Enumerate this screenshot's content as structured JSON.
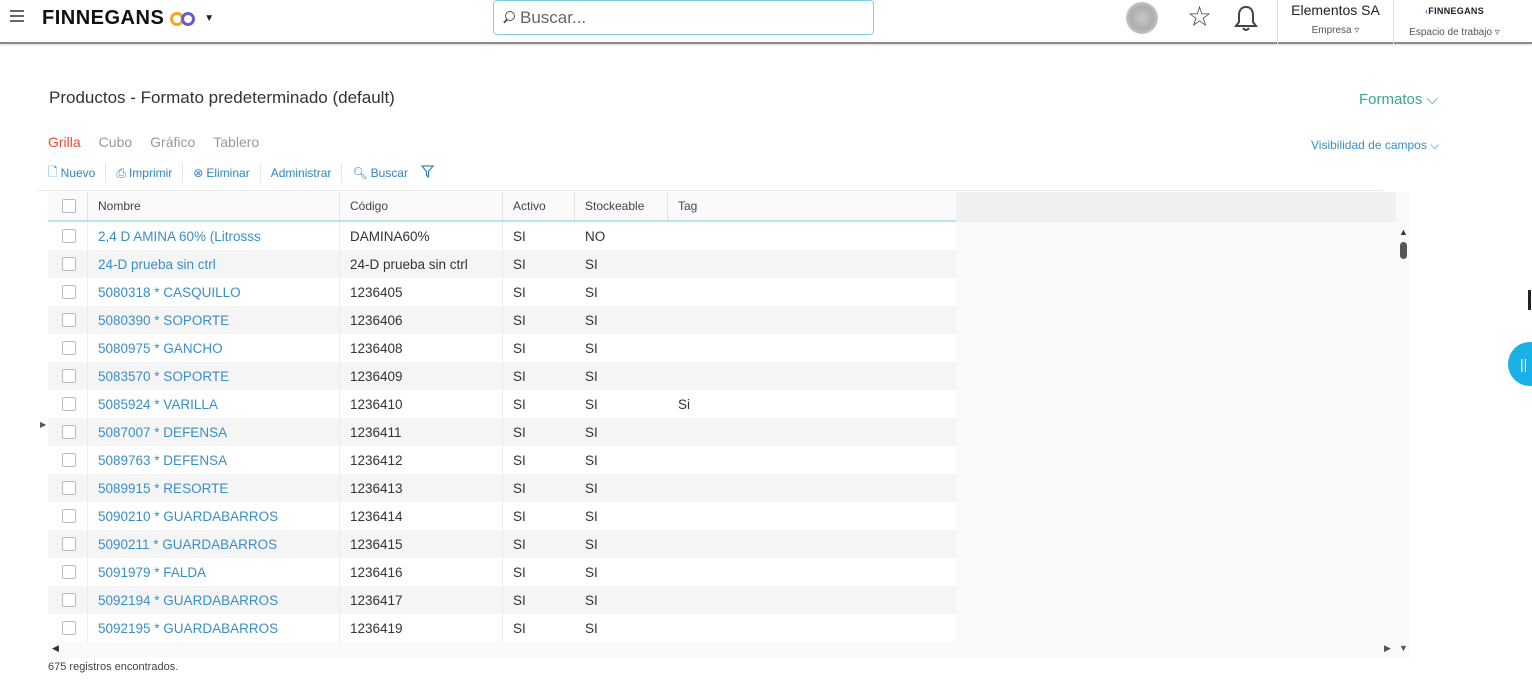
{
  "header": {
    "brand": "FINNEGANS",
    "search_placeholder": "Buscar...",
    "company_name": "Elementos SA",
    "company_label": "Empresa ▿",
    "workspace_logo": "FINNEGANS",
    "workspace_label": "Espacio de trabajo ▿"
  },
  "page": {
    "title": "Productos - Formato predeterminado (default)",
    "formatos": "Formatos ⌵",
    "visibilidad": "Visibilidad de campos ⌵"
  },
  "views": [
    "Grilla",
    "Cubo",
    "Gráfico",
    "Tablero"
  ],
  "toolbar": {
    "nuevo": "Nuevo",
    "imprimir": "Imprimir",
    "eliminar": "Eliminar",
    "administrar": "Administrar",
    "buscar": "Buscar"
  },
  "grid": {
    "columns": [
      "Nombre",
      "Código",
      "Activo",
      "Stockeable",
      "Tag"
    ],
    "rows": [
      {
        "nombre": "2,4 D AMINA 60% (Litrosss",
        "codigo": "DAMINA60%",
        "activo": "SI",
        "stock": "NO",
        "tag": ""
      },
      {
        "nombre": "24-D prueba sin ctrl",
        "codigo": "24-D prueba sin ctrl",
        "activo": "SI",
        "stock": "SI",
        "tag": ""
      },
      {
        "nombre": "5080318 * CASQUILLO",
        "codigo": "1236405",
        "activo": "SI",
        "stock": "SI",
        "tag": ""
      },
      {
        "nombre": "5080390 * SOPORTE",
        "codigo": "1236406",
        "activo": "SI",
        "stock": "SI",
        "tag": ""
      },
      {
        "nombre": "5080975 * GANCHO",
        "codigo": "1236408",
        "activo": "SI",
        "stock": "SI",
        "tag": ""
      },
      {
        "nombre": "5083570 * SOPORTE",
        "codigo": "1236409",
        "activo": "SI",
        "stock": "SI",
        "tag": ""
      },
      {
        "nombre": "5085924 * VARILLA",
        "codigo": "1236410",
        "activo": "SI",
        "stock": "SI",
        "tag": "Si"
      },
      {
        "nombre": "5087007 * DEFENSA",
        "codigo": "1236411",
        "activo": "SI",
        "stock": "SI",
        "tag": ""
      },
      {
        "nombre": "5089763 * DEFENSA",
        "codigo": "1236412",
        "activo": "SI",
        "stock": "SI",
        "tag": ""
      },
      {
        "nombre": "5089915 * RESORTE",
        "codigo": "1236413",
        "activo": "SI",
        "stock": "SI",
        "tag": ""
      },
      {
        "nombre": "5090210 * GUARDABARROS",
        "codigo": "1236414",
        "activo": "SI",
        "stock": "SI",
        "tag": ""
      },
      {
        "nombre": "5090211 * GUARDABARROS",
        "codigo": "1236415",
        "activo": "SI",
        "stock": "SI",
        "tag": ""
      },
      {
        "nombre": "5091979 * FALDA",
        "codigo": "1236416",
        "activo": "SI",
        "stock": "SI",
        "tag": ""
      },
      {
        "nombre": "5092194 * GUARDABARROS",
        "codigo": "1236417",
        "activo": "SI",
        "stock": "SI",
        "tag": ""
      },
      {
        "nombre": "5092195 * GUARDABARROS",
        "codigo": "1236419",
        "activo": "SI",
        "stock": "SI",
        "tag": ""
      }
    ]
  },
  "footer": {
    "records": "675 registros encontrados."
  },
  "colors": {
    "accent_blue": "#3a8fc4",
    "active_tab": "#e74c3c",
    "formatos_green": "#3aa88a",
    "float_button": "#1ab0e8"
  }
}
